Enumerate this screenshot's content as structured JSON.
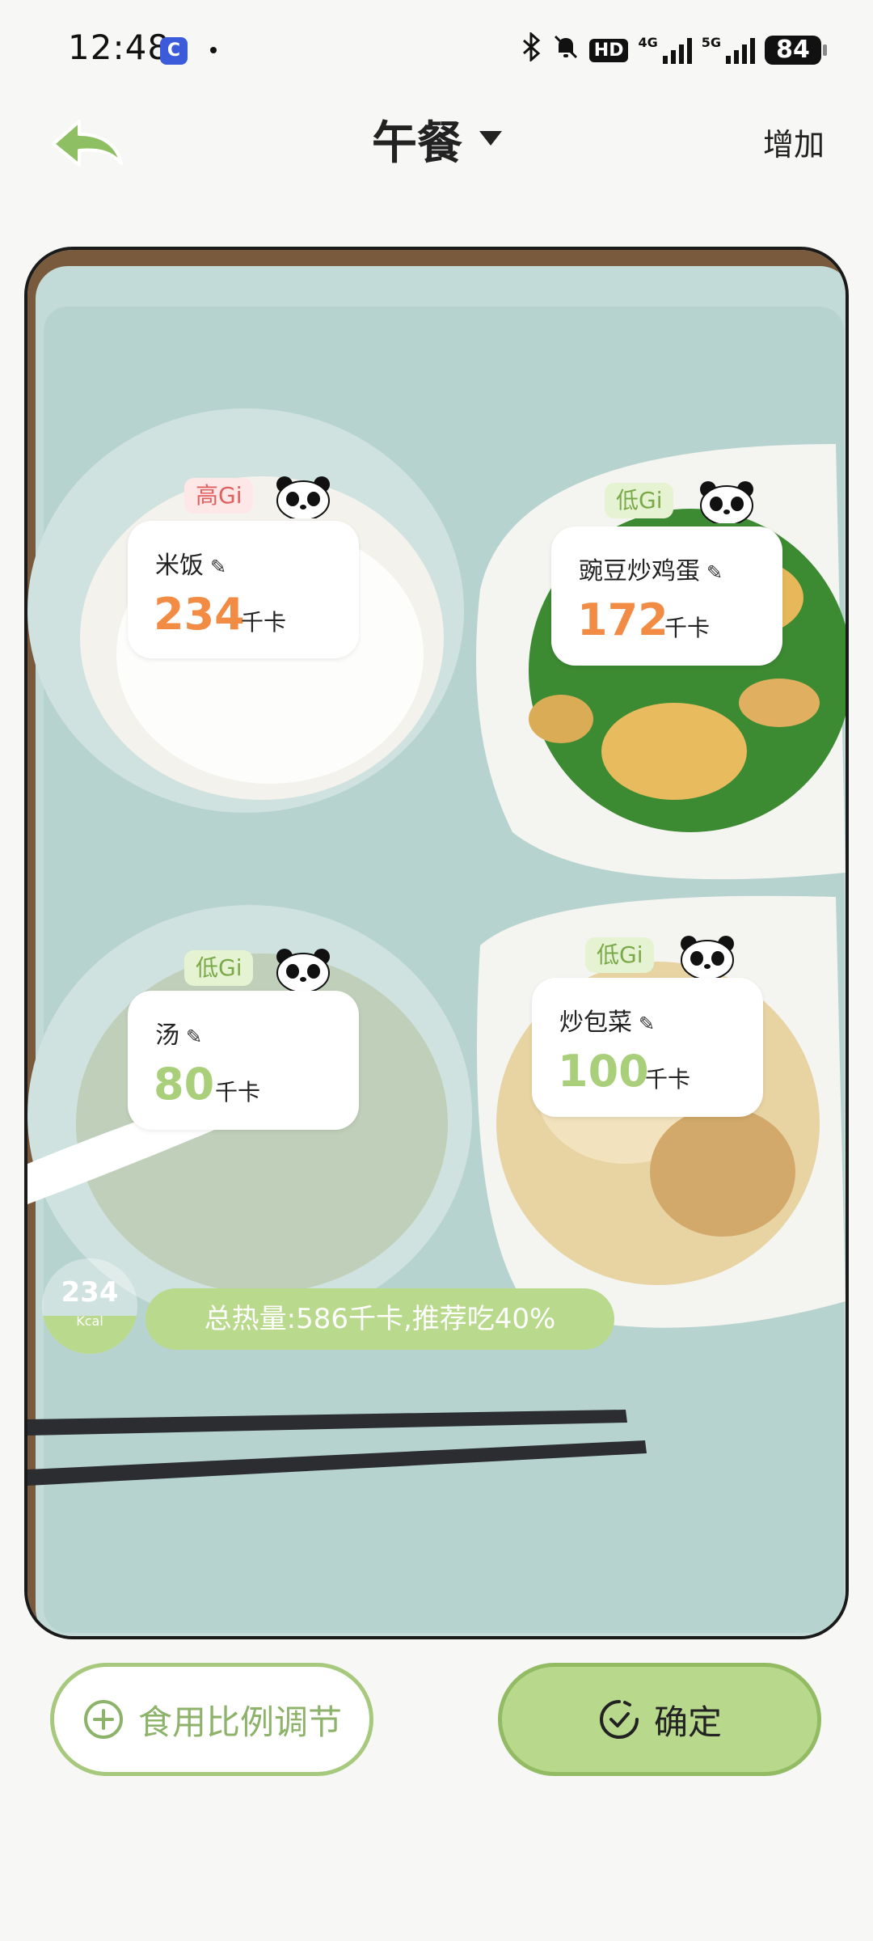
{
  "status_bar": {
    "time": "12:48",
    "app_icon": "C",
    "hd_badge": "HD",
    "network_1": "4G",
    "network_2": "5G",
    "battery": "84"
  },
  "header": {
    "title": "午餐",
    "add_label": "增加"
  },
  "foods": [
    {
      "name": "米饭",
      "kcal": "234",
      "unit": "千卡",
      "gi": "高Gi",
      "gi_level": "high",
      "color": "#f28c45"
    },
    {
      "name": "豌豆炒鸡蛋",
      "kcal": "172",
      "unit": "千卡",
      "gi": "低Gi",
      "gi_level": "low",
      "color": "#f28c45"
    },
    {
      "name": "汤",
      "kcal": "80",
      "unit": "千卡",
      "gi": "低Gi",
      "gi_level": "low",
      "color": "#a9cf7a"
    },
    {
      "name": "炒包菜",
      "kcal": "100",
      "unit": "千卡",
      "gi": "低Gi",
      "gi_level": "low",
      "color": "#a9cf7a"
    }
  ],
  "summary": {
    "circle_value": "234",
    "circle_unit": "Kcal",
    "total_text": "总热量:586千卡,推荐吃40%",
    "recommend_fraction": 0.4
  },
  "actions": {
    "adjust_label": "食用比例调节",
    "confirm_label": "确定"
  },
  "colors": {
    "accent_green": "#b8d88c",
    "accent_orange": "#f28c45",
    "high_gi": "#e06060",
    "low_gi": "#7aa94a"
  }
}
